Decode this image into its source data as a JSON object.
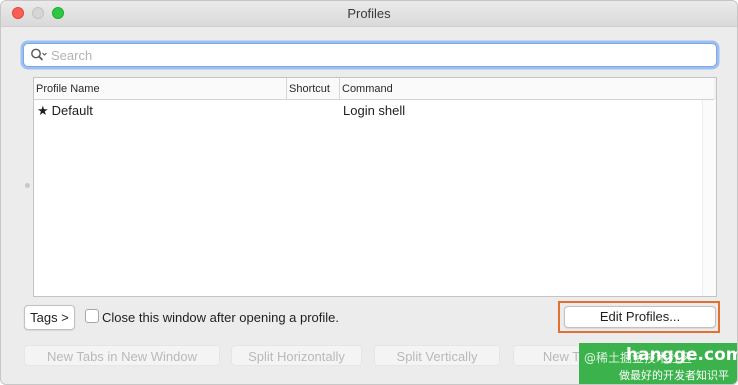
{
  "window": {
    "title": "Profiles"
  },
  "search": {
    "placeholder": "Search",
    "value": ""
  },
  "table": {
    "columns": [
      "Profile Name",
      "Shortcut",
      "Command"
    ],
    "rows": [
      {
        "name": "Default",
        "is_default": true,
        "shortcut": "",
        "command": "Login shell"
      }
    ]
  },
  "footer": {
    "tags_label": "Tags >",
    "close_checkbox_label": "Close this window after opening a profile.",
    "close_checkbox_checked": false,
    "edit_profiles_label": "Edit Profiles...",
    "disabled_buttons": [
      "New Tabs in New Window",
      "Split Horizontally",
      "Split Vertically",
      "New Tab"
    ]
  },
  "watermark": {
    "prefix": "@稀土掘金技术社区",
    "main": "hangge.com",
    "sub": "做最好的开发者知识平台"
  },
  "colors": {
    "highlight": "#e2702f",
    "focus_ring": "#9dc0f3",
    "close_button": "#fd5f57",
    "zoom_button": "#2bc840",
    "watermark_bg": "#3bb24b"
  },
  "icons": {
    "star": "★",
    "search": "search-icon",
    "chevron": "chevron-down-icon"
  }
}
